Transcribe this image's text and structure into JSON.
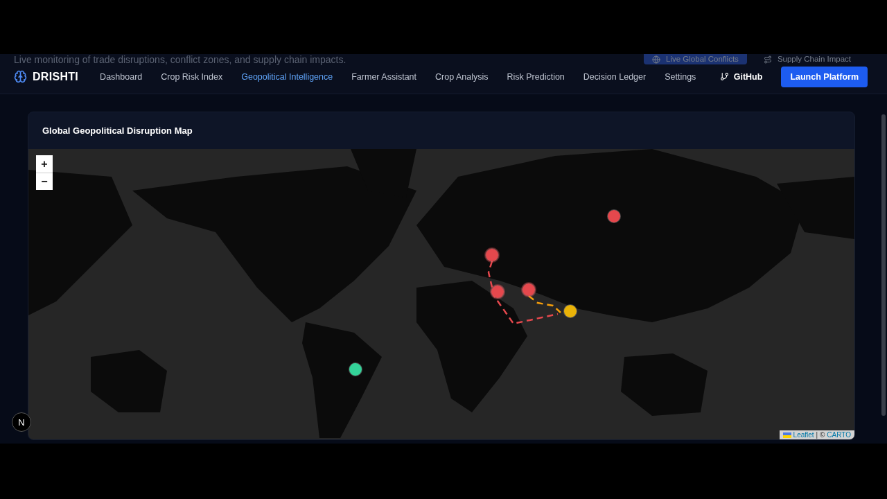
{
  "behind_header": {
    "subtitle": "Live monitoring of trade disruptions, conflict zones, and supply chain impacts.",
    "tabs": [
      {
        "label": "Live Global Conflicts",
        "selected": true
      },
      {
        "label": "Supply Chain Impact",
        "selected": false
      }
    ]
  },
  "brand": "DRISHTI",
  "nav": [
    {
      "label": "Dashboard",
      "selected": false
    },
    {
      "label": "Crop Risk Index",
      "selected": false
    },
    {
      "label": "Geopolitical Intelligence",
      "selected": true
    },
    {
      "label": "Farmer Assistant",
      "selected": false
    },
    {
      "label": "Crop Analysis",
      "selected": false
    },
    {
      "label": "Risk Prediction",
      "selected": false
    },
    {
      "label": "Decision Ledger",
      "selected": false
    },
    {
      "label": "Settings",
      "selected": false
    }
  ],
  "github": "GitHub",
  "launch_button": "Launch Platform",
  "card": {
    "title": "Global Geopolitical Disruption Map",
    "zoom_in": "+",
    "zoom_out": "−",
    "markers": [
      {
        "kind": "dot",
        "color": "#e5484d"
      },
      {
        "kind": "pin",
        "color": "#e5484d"
      },
      {
        "kind": "pin",
        "color": "#e5484d"
      },
      {
        "kind": "pin",
        "color": "#e5484d"
      },
      {
        "kind": "dot",
        "color": "#eab308"
      },
      {
        "kind": "dot",
        "color": "#34d399"
      }
    ],
    "routes": [
      {
        "color": "#e5484d"
      },
      {
        "color": "#f59e0b"
      }
    ],
    "attribution": {
      "leaflet": "Leaflet",
      "separator": "| ©",
      "carto": "CARTO"
    }
  },
  "dev_badge": "N"
}
